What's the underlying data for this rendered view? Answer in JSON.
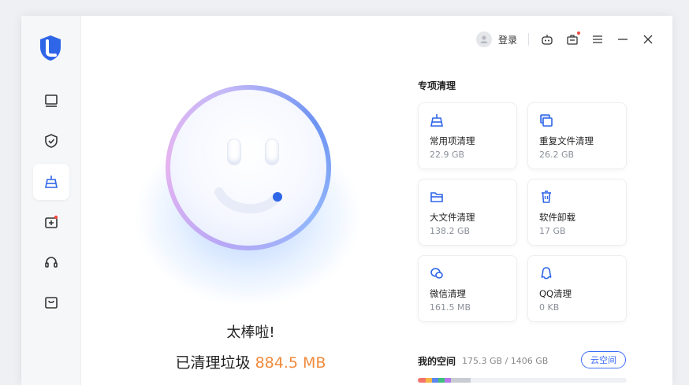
{
  "topbar": {
    "login_label": "登录"
  },
  "main": {
    "message": "太棒啦!",
    "cleaned_prefix": "已清理垃圾",
    "cleaned_amount": "884.5 MB"
  },
  "special": {
    "title": "专项清理",
    "cards": [
      {
        "name": "常用项清理",
        "size": "22.9 GB",
        "icon": "brush-icon"
      },
      {
        "name": "重复文件清理",
        "size": "26.2 GB",
        "icon": "duplicate-files-icon"
      },
      {
        "name": "大文件清理",
        "size": "138.2 GB",
        "icon": "folder-icon"
      },
      {
        "name": "软件卸载",
        "size": "17 GB",
        "icon": "trash-icon"
      },
      {
        "name": "微信清理",
        "size": "161.5 MB",
        "icon": "wechat-icon"
      },
      {
        "name": "QQ清理",
        "size": "0 KB",
        "icon": "qq-icon"
      }
    ]
  },
  "space": {
    "label": "我的空间",
    "used": "175.3 GB / 1406 GB",
    "cloud_button": "云空间",
    "used_fraction": 0.125
  },
  "colors": {
    "accent": "#3c6ef5",
    "amount": "#f08a3c"
  }
}
